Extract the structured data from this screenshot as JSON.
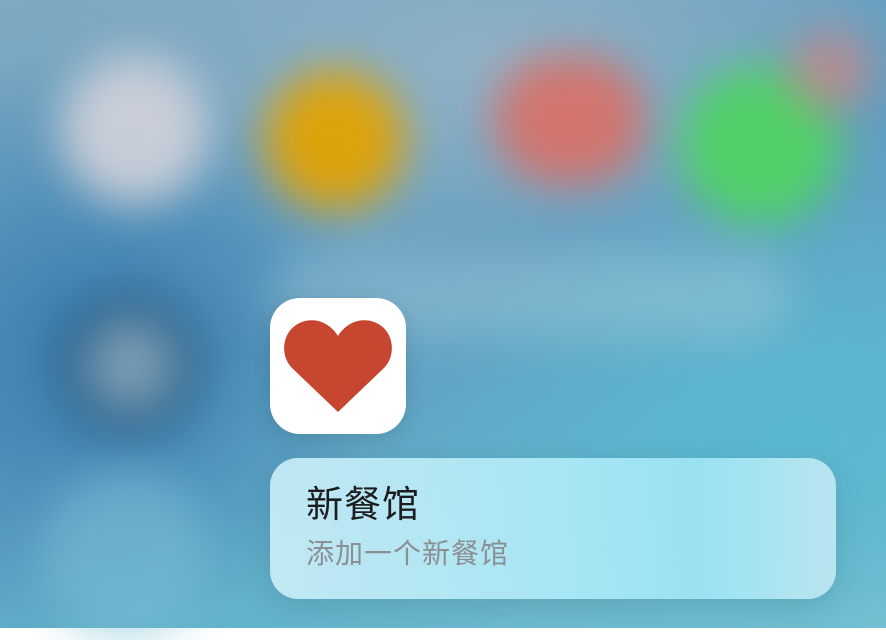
{
  "app": {
    "icon": "heart-icon",
    "icon_color": "#c64630"
  },
  "quick_action": {
    "title": "新餐馆",
    "subtitle": "添加一个新餐馆"
  }
}
